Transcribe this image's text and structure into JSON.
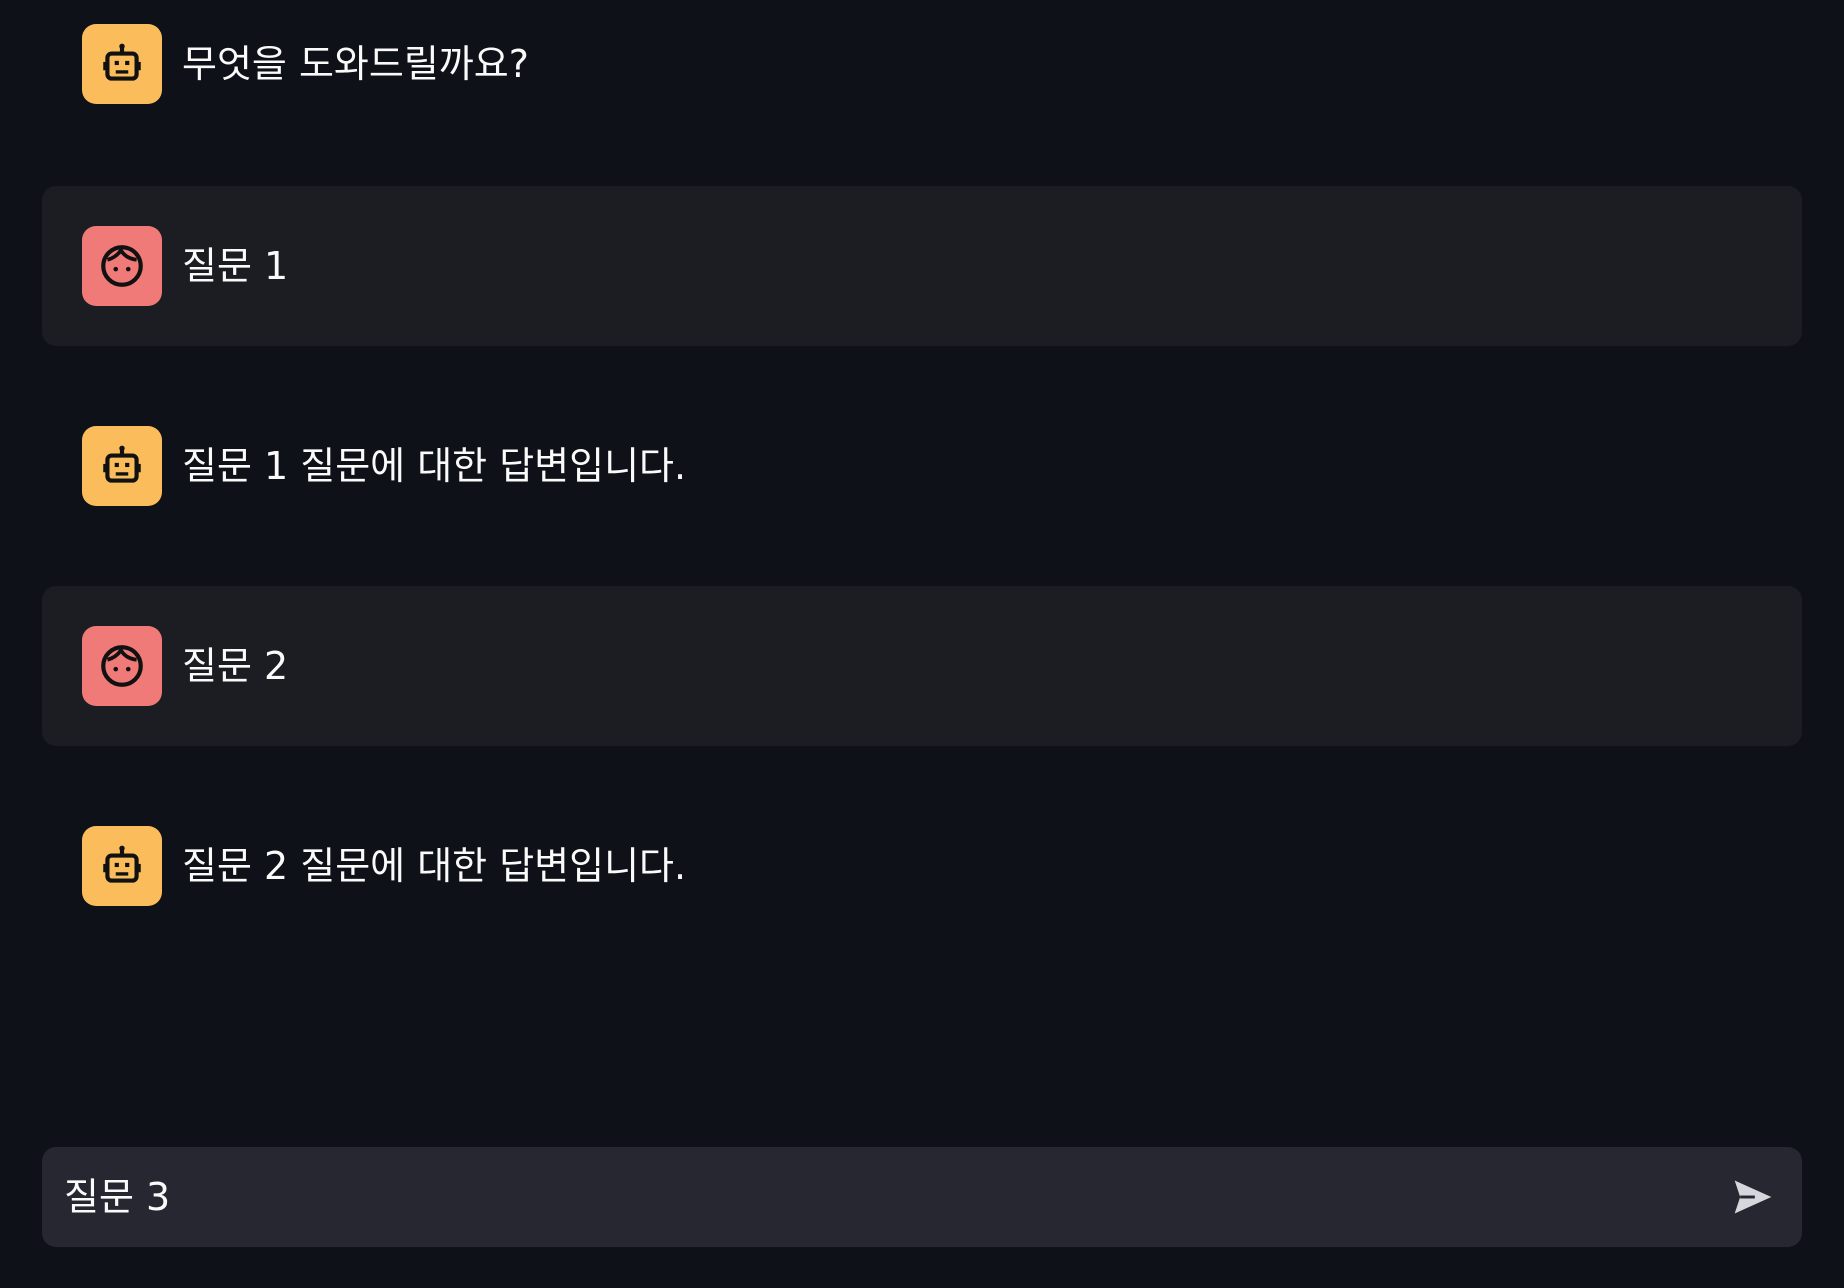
{
  "messages": [
    {
      "role": "assistant",
      "avatar_icon": "robot-icon",
      "text": "무엇을 도와드릴까요?"
    },
    {
      "role": "user",
      "avatar_icon": "face-icon",
      "text": "질문 1"
    },
    {
      "role": "assistant",
      "avatar_icon": "robot-icon",
      "text": "질문 1 질문에 대한 답변입니다."
    },
    {
      "role": "user",
      "avatar_icon": "face-icon",
      "text": "질문 2"
    },
    {
      "role": "assistant",
      "avatar_icon": "robot-icon",
      "text": "질문 2 질문에 대한 답변입니다."
    }
  ],
  "chat_input": {
    "value": "질문 3",
    "send_icon": "send-icon"
  },
  "colors": {
    "background": "#0e1117",
    "user_message_bg": "#1b1d22",
    "assistant_avatar": "#fbbd5c",
    "user_avatar": "#f07a78",
    "input_bg": "#262730",
    "text": "#fafafa"
  }
}
